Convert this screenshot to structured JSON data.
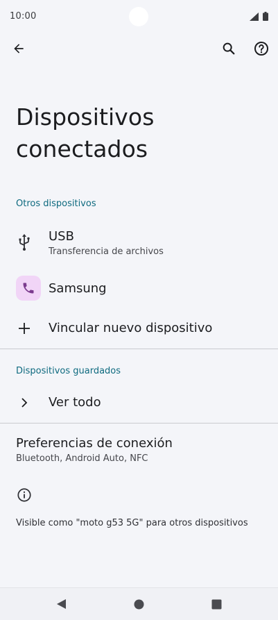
{
  "status_bar": {
    "time": "10:00"
  },
  "toolbar": {
    "back_icon": "arrow-back-icon",
    "search_icon": "search-icon",
    "help_icon": "help-icon"
  },
  "page": {
    "title": "Dispositivos conectados"
  },
  "other_devices": {
    "header": "Otros dispositivos",
    "usb": {
      "title": "USB",
      "subtitle": "Transferencia de archivos",
      "icon": "usb-icon"
    },
    "samsung": {
      "title": "Samsung",
      "icon": "phone-icon",
      "icon_bg": "#f1d5f7",
      "icon_color": "#7b3b8e"
    },
    "pair": {
      "title": "Vincular nuevo dispositivo",
      "icon": "plus-icon"
    }
  },
  "saved_devices": {
    "header": "Dispositivos guardados",
    "see_all": {
      "title": "Ver todo",
      "icon": "chevron-right-icon"
    }
  },
  "connection_prefs": {
    "title": "Preferencias de conexión",
    "subtitle": "Bluetooth, Android Auto, NFC"
  },
  "info": {
    "icon": "info-icon",
    "text": "Visible como \"moto g53 5G\" para otros dispositivos"
  },
  "colors": {
    "background": "#f4f5f9",
    "accent": "#0e6a7f",
    "divider": "#c9cacf"
  },
  "nav_bar": {
    "back": "nav-back-icon",
    "home": "nav-home-icon",
    "recents": "nav-recents-icon"
  }
}
